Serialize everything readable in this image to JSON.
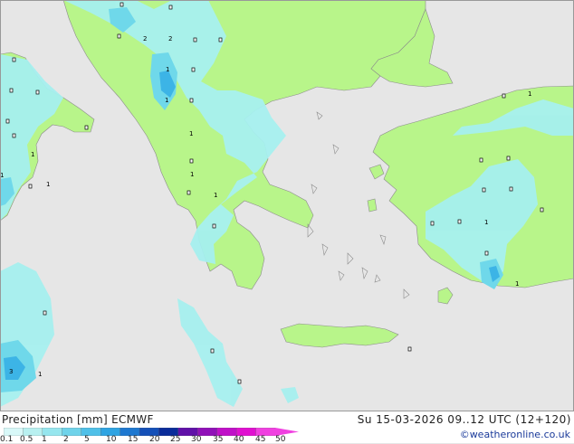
{
  "map": {
    "value_labels": [
      "2",
      "2",
      "1",
      "1",
      "1",
      "1",
      "1",
      "1",
      "1",
      "1",
      "1",
      "1",
      "1",
      "3",
      "1"
    ],
    "colors": {
      "sea": "#e6e6e6",
      "land": "#b8f58a",
      "precip_light": "#a6f0ef",
      "precip_mid": "#6fd8ea",
      "precip_heavy": "#3cb4e6",
      "coast": "#8c8c8c"
    }
  },
  "footer": {
    "title": "Precipitation [mm]  ECMWF",
    "datetime": "Su 15-03-2026 09..12 UTC (12+120)",
    "credit": "©weatheronline.co.uk",
    "scale_labels": [
      "0.1",
      "0.5",
      "1",
      "2",
      "5",
      "10",
      "15",
      "20",
      "25",
      "30",
      "35",
      "40",
      "45",
      "50"
    ],
    "scale_colors": [
      "#d8f8f8",
      "#b8f0f0",
      "#96e6ee",
      "#6fd3ea",
      "#4fc0e8",
      "#2fa4e2",
      "#1e78d0",
      "#1450b8",
      "#0a2c9a",
      "#6010a8",
      "#9010b8",
      "#c010c8",
      "#e010d0",
      "#f040e0"
    ]
  }
}
